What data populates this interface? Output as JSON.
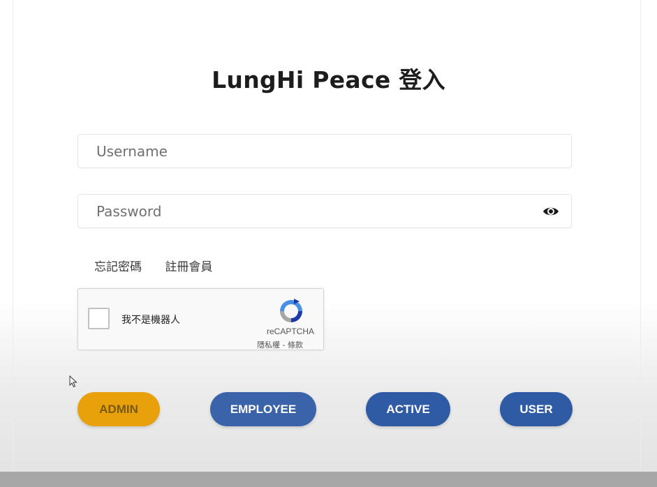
{
  "title": "LungHi Peace 登入",
  "username": {
    "placeholder": "Username",
    "value": ""
  },
  "password": {
    "placeholder": "Password",
    "value": "",
    "icon": "eye-icon"
  },
  "links": {
    "forgot": "忘記密碼",
    "register": "註冊會員"
  },
  "recaptcha": {
    "label": "我不是機器人",
    "brand": "reCAPTCHA",
    "terms": "隱私權 - 條款",
    "checked": false
  },
  "roles": {
    "admin": "ADMIN",
    "employee": "EMPLOYEE",
    "active": "ACTIVE",
    "user": "USER"
  },
  "colors": {
    "admin": "#e8a10b",
    "primary": "#2f5ba4",
    "bottom_bar": "#a7a7a7"
  }
}
